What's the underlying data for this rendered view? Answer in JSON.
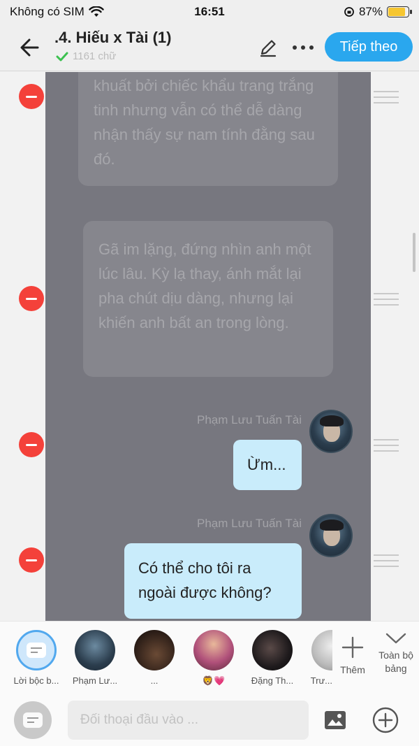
{
  "status_bar": {
    "carrier": "Không có SIM",
    "time": "16:51",
    "battery": "87%",
    "battery_level": 0.87
  },
  "header": {
    "title": ".4. Hiếu x Tài (1)",
    "word_count": "1161 chữ",
    "next_label": "Tiếp theo"
  },
  "messages": {
    "narration_1": "khuất bởi chiếc khẩu trang trắng tinh nhưng vẫn có thể dễ dàng nhận thấy sự nam tính đằng sau đó.",
    "narration_2": "Gã im lặng, đứng nhìn anh một lúc lâu. Kỳ lạ thay, ánh mắt lại pha chút dịu dàng, nhưng lại khiến anh bất an trong lòng.",
    "dialog_1": {
      "speaker": "Phạm Lưu Tuấn Tài",
      "text": "Ừm..."
    },
    "dialog_2": {
      "speaker": "Phạm Lưu Tuấn Tài",
      "text": "Có thể cho tôi ra ngoài được không?"
    }
  },
  "characters": [
    {
      "label": "Lời bộc b..."
    },
    {
      "label": "Phạm Lư..."
    },
    {
      "label": "..."
    },
    {
      "label": "🦁💗"
    },
    {
      "label": "Đặng Th..."
    },
    {
      "label": "Trư..."
    }
  ],
  "char_actions": {
    "add_label": "Thêm",
    "all_table_label": "Toàn bộ bảng"
  },
  "input": {
    "placeholder": "Đối thoại đầu vào ..."
  },
  "colors": {
    "accent": "#2aa7ee",
    "delete": "#f4413a",
    "dialog_bubble": "#c9ecfb"
  }
}
